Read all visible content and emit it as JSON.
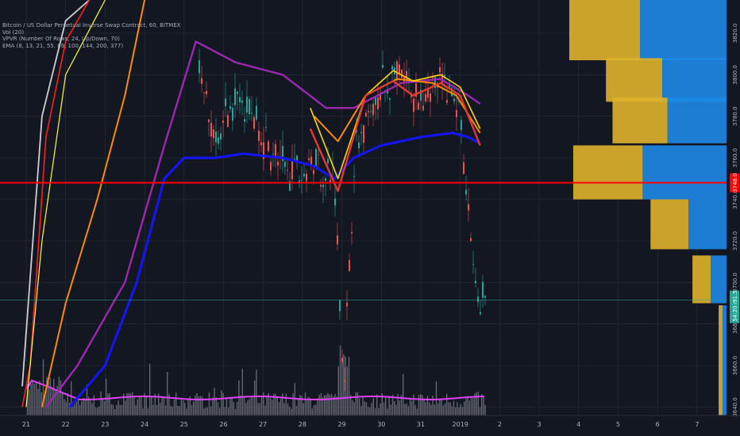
{
  "legend": [
    "Bitcoin / US Dollar Perpetual Inverse Swap Contract, 60, BITMEX",
    "Vol (20)",
    "VPVR (Number Of Rows, 24, Up/Down, 70)",
    "EMA (8, 13, 21, 55, 89, 100, 144, 200, 377)"
  ],
  "colors": {
    "background": "#131722",
    "grid": "#2a2e39",
    "up_candle": "#26a69a",
    "down_candle": "#ef5350",
    "current_price_line": "#ff0000",
    "vpvr_up": "#e0b22b",
    "vpvr_down": "#1e88e5",
    "volume_ma": "#e040fb",
    "ema_colors": [
      "#ffeb3b",
      "#ff9800",
      "#4dd0e1",
      "#ef5350",
      "#9c27b0",
      "#1e22ff",
      "#ff5722",
      "#d0d0d0",
      "#ffeb3b"
    ]
  },
  "chart_data": {
    "type": "line",
    "symbol": "XBTUSD",
    "x_ticks": [
      "21",
      "22",
      "23",
      "24",
      "25",
      "26",
      "27",
      "28",
      "29",
      "30",
      "31",
      "2019",
      "2",
      "3",
      "4",
      "5",
      "6",
      "7"
    ],
    "y_ticks": [
      "3640.0",
      "3660.0",
      "3680.0",
      "3700.0",
      "3720.0",
      "3740.0",
      "3760.0",
      "3780.0",
      "3800.0",
      "3820.0"
    ],
    "ylim": [
      3636,
      3836
    ],
    "current_price": 3748.0,
    "current_price_label": "3748.0",
    "price_label_2": "3691.5",
    "price_label_3": "54:20",
    "series": [
      {
        "name": "EMA 377",
        "values": [
          [
            20.9,
            3650
          ],
          [
            21.4,
            3780
          ],
          [
            22.0,
            3826
          ],
          [
            22.6,
            3836
          ]
        ]
      },
      {
        "name": "EMA 8",
        "values": [
          [
            20.9,
            3640
          ],
          [
            21.1,
            3660
          ],
          [
            21.5,
            3770
          ],
          [
            22.0,
            3816
          ],
          [
            22.6,
            3836
          ]
        ]
      },
      {
        "name": "EMA 13",
        "values": [
          [
            21.0,
            3640
          ],
          [
            21.4,
            3720
          ],
          [
            22.0,
            3800
          ],
          [
            23.0,
            3836
          ]
        ]
      },
      {
        "name": "EMA 21",
        "values": [
          [
            21.4,
            3640
          ],
          [
            22.0,
            3690
          ],
          [
            22.8,
            3740
          ],
          [
            23.5,
            3790
          ],
          [
            24.0,
            3836
          ]
        ]
      },
      {
        "name": "EMA 144",
        "values": [
          [
            21.5,
            3640
          ],
          [
            22.3,
            3660
          ],
          [
            23.5,
            3700
          ],
          [
            24.5,
            3766
          ],
          [
            25.3,
            3816
          ],
          [
            26.3,
            3806
          ],
          [
            27.5,
            3800
          ],
          [
            28.6,
            3784
          ],
          [
            29.3,
            3784
          ],
          [
            30.5,
            3796
          ],
          [
            31.5,
            3798
          ],
          [
            32.2,
            3790
          ],
          [
            32.5,
            3786
          ]
        ]
      },
      {
        "name": "EMA 200",
        "values": [
          [
            22.1,
            3640
          ],
          [
            23.0,
            3660
          ],
          [
            23.8,
            3700
          ],
          [
            24.5,
            3750
          ],
          [
            25.0,
            3760
          ],
          [
            25.8,
            3760
          ],
          [
            26.5,
            3762
          ],
          [
            27.5,
            3760
          ],
          [
            28.3,
            3756
          ],
          [
            28.8,
            3750
          ],
          [
            29.3,
            3760
          ],
          [
            30.0,
            3766
          ],
          [
            31.0,
            3770
          ],
          [
            31.8,
            3772
          ],
          [
            32.2,
            3770
          ],
          [
            32.5,
            3767
          ]
        ]
      },
      {
        "name": "EMA 89",
        "values": [
          [
            28.3,
            3780
          ],
          [
            28.9,
            3768
          ],
          [
            29.6,
            3790
          ],
          [
            30.4,
            3798
          ],
          [
            31.3,
            3796
          ],
          [
            31.9,
            3790
          ],
          [
            32.5,
            3772
          ]
        ]
      },
      {
        "name": "EMA 55",
        "values": [
          [
            28.2,
            3784
          ],
          [
            28.9,
            3750
          ],
          [
            29.6,
            3790
          ],
          [
            30.3,
            3802
          ],
          [
            30.8,
            3797
          ],
          [
            31.5,
            3800
          ],
          [
            32.0,
            3794
          ],
          [
            32.5,
            3774
          ]
        ]
      },
      {
        "name": "EMA 100",
        "values": [
          [
            28.2,
            3774
          ],
          [
            28.9,
            3744
          ],
          [
            29.6,
            3790
          ],
          [
            30.3,
            3797
          ],
          [
            30.8,
            3790
          ],
          [
            31.5,
            3796
          ],
          [
            32.0,
            3790
          ],
          [
            32.5,
            3766
          ]
        ]
      }
    ],
    "vpvr_rows": [
      {
        "low": 3807,
        "high": 3836,
        "up": 0.54,
        "down": 0.66
      },
      {
        "low": 3787,
        "high": 3808,
        "up": 0.43,
        "down": 0.49
      },
      {
        "low": 3767,
        "high": 3789,
        "up": 0.42,
        "down": 0.45
      },
      {
        "low": 3740,
        "high": 3766,
        "up": 0.53,
        "down": 0.64
      },
      {
        "low": 3716,
        "high": 3740,
        "up": 0.29,
        "down": 0.29
      },
      {
        "low": 3690,
        "high": 3713,
        "up": 0.14,
        "down": 0.12
      },
      {
        "low": 3636,
        "high": 3689,
        "up": 0.03,
        "down": 0.03
      }
    ]
  }
}
